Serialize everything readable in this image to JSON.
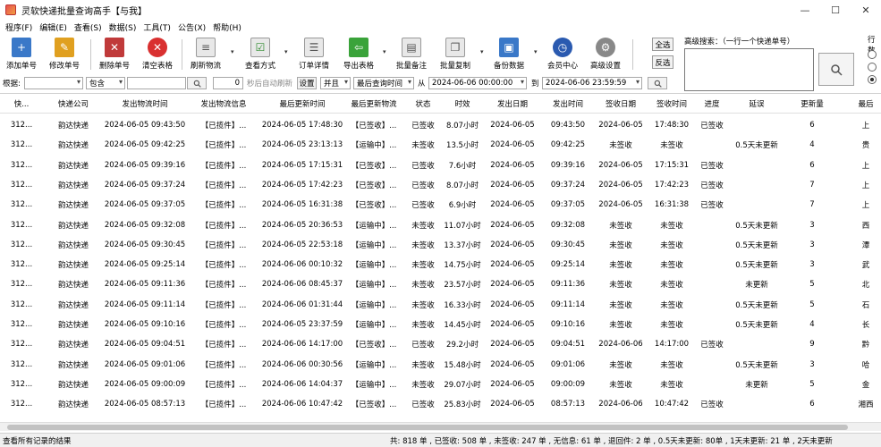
{
  "window": {
    "title": "灵软快递批量查询高手【与我】",
    "buttons": [
      "—",
      "☐",
      "✕"
    ]
  },
  "menu": [
    "程序(F)",
    "编辑(E)",
    "查看(S)",
    "数据(S)",
    "工具(T)",
    "公告(X)",
    "帮助(H)"
  ],
  "toolbar": {
    "add": "添加单号",
    "edit": "修改单号",
    "delete": "删除单号",
    "clear": "清空表格",
    "refresh": "刷新物流",
    "view_mode": "查看方式",
    "order_detail": "订单详情",
    "export": "导出表格",
    "batch_note": "批量备注",
    "batch_copy": "批量复制",
    "backup": "备份数据",
    "member": "会员中心",
    "settings": "高级设置",
    "select_all": "全选",
    "invert": "反选",
    "adv_search_label": "高级搜索：（一行一个快递单号）",
    "side_label": "行数"
  },
  "filter": {
    "label": "根据:",
    "field1": "",
    "match": "包含",
    "keyword": "",
    "seconds": "0",
    "auto_refresh": "秒后自动刷新",
    "settings_btn": "设置",
    "join": "并且",
    "field2": "最后查询时间",
    "from_label": "从",
    "from_date": "2024-06-06 00:00:00",
    "to_label": "到",
    "to_date": "2024-06-06 23:59:59"
  },
  "table": {
    "columns": [
      "快...",
      "快递公司",
      "发出物流时间",
      "发出物流信息",
      "最后更新时间",
      "最后更新物流",
      "状态",
      "时效",
      "发出日期",
      "发出时间",
      "签收日期",
      "签收时间",
      "进度",
      "延误",
      "更新量",
      "最后"
    ],
    "rows": [
      [
        "312...",
        "韵达快递",
        "2024-06-05 09:43:50",
        "【已揽件】...",
        "2024-06-05 17:48:30",
        "【已签收】...",
        "已签收",
        "8.07小时",
        "2024-06-05",
        "09:43:50",
        "2024-06-05",
        "17:48:30",
        "已签收",
        "",
        "6",
        "上"
      ],
      [
        "312...",
        "韵达快递",
        "2024-06-05 09:42:25",
        "【已揽件】...",
        "2024-06-05 23:13:13",
        "【运输中】...",
        "未签收",
        "13.5小时",
        "2024-06-05",
        "09:42:25",
        "未签收",
        "未签收",
        "",
        "0.5天未更新",
        "4",
        "贵"
      ],
      [
        "312...",
        "韵达快递",
        "2024-06-05 09:39:16",
        "【已揽件】...",
        "2024-06-05 17:15:31",
        "【已签收】...",
        "已签收",
        "7.6小时",
        "2024-06-05",
        "09:39:16",
        "2024-06-05",
        "17:15:31",
        "已签收",
        "",
        "6",
        "上"
      ],
      [
        "312...",
        "韵达快递",
        "2024-06-05 09:37:24",
        "【已揽件】...",
        "2024-06-05 17:42:23",
        "【已签收】...",
        "已签收",
        "8.07小时",
        "2024-06-05",
        "09:37:24",
        "2024-06-05",
        "17:42:23",
        "已签收",
        "",
        "7",
        "上"
      ],
      [
        "312...",
        "韵达快递",
        "2024-06-05 09:37:05",
        "【已揽件】...",
        "2024-06-05 16:31:38",
        "【已签收】...",
        "已签收",
        "6.9小时",
        "2024-06-05",
        "09:37:05",
        "2024-06-05",
        "16:31:38",
        "已签收",
        "",
        "7",
        "上"
      ],
      [
        "312...",
        "韵达快递",
        "2024-06-05 09:32:08",
        "【已揽件】...",
        "2024-06-05 20:36:53",
        "【运输中】...",
        "未签收",
        "11.07小时",
        "2024-06-05",
        "09:32:08",
        "未签收",
        "未签收",
        "",
        "0.5天未更新",
        "3",
        "西"
      ],
      [
        "312...",
        "韵达快递",
        "2024-06-05 09:30:45",
        "【已揽件】...",
        "2024-06-05 22:53:18",
        "【运输中】...",
        "未签收",
        "13.37小时",
        "2024-06-05",
        "09:30:45",
        "未签收",
        "未签收",
        "",
        "0.5天未更新",
        "3",
        "潭"
      ],
      [
        "312...",
        "韵达快递",
        "2024-06-05 09:25:14",
        "【已揽件】...",
        "2024-06-06 00:10:32",
        "【运输中】...",
        "未签收",
        "14.75小时",
        "2024-06-05",
        "09:25:14",
        "未签收",
        "未签收",
        "",
        "0.5天未更新",
        "3",
        "武"
      ],
      [
        "312...",
        "韵达快递",
        "2024-06-05 09:11:36",
        "【已揽件】...",
        "2024-06-06 08:45:37",
        "【运输中】...",
        "未签收",
        "23.57小时",
        "2024-06-05",
        "09:11:36",
        "未签收",
        "未签收",
        "",
        "未更新",
        "5",
        "北"
      ],
      [
        "312...",
        "韵达快递",
        "2024-06-05 09:11:14",
        "【已揽件】...",
        "2024-06-06 01:31:44",
        "【运输中】...",
        "未签收",
        "16.33小时",
        "2024-06-05",
        "09:11:14",
        "未签收",
        "未签收",
        "",
        "0.5天未更新",
        "5",
        "石"
      ],
      [
        "312...",
        "韵达快递",
        "2024-06-05 09:10:16",
        "【已揽件】...",
        "2024-06-05 23:37:59",
        "【运输中】...",
        "未签收",
        "14.45小时",
        "2024-06-05",
        "09:10:16",
        "未签收",
        "未签收",
        "",
        "0.5天未更新",
        "4",
        "长"
      ],
      [
        "312...",
        "韵达快递",
        "2024-06-05 09:04:51",
        "【已揽件】...",
        "2024-06-06 14:17:00",
        "【已签收】...",
        "已签收",
        "29.2小时",
        "2024-06-05",
        "09:04:51",
        "2024-06-06",
        "14:17:00",
        "已签收",
        "",
        "9",
        "黔"
      ],
      [
        "312...",
        "韵达快递",
        "2024-06-05 09:01:06",
        "【已揽件】...",
        "2024-06-06 00:30:56",
        "【运输中】...",
        "未签收",
        "15.48小时",
        "2024-06-05",
        "09:01:06",
        "未签收",
        "未签收",
        "",
        "0.5天未更新",
        "3",
        "哈"
      ],
      [
        "312...",
        "韵达快递",
        "2024-06-05 09:00:09",
        "【已揽件】...",
        "2024-06-06 14:04:37",
        "【运输中】...",
        "未签收",
        "29.07小时",
        "2024-06-05",
        "09:00:09",
        "未签收",
        "未签收",
        "",
        "未更新",
        "5",
        "金"
      ],
      [
        "312...",
        "韵达快递",
        "2024-06-05 08:57:13",
        "【已揽件】...",
        "2024-06-06 10:47:42",
        "【已签收】...",
        "已签收",
        "25.83小时",
        "2024-06-05",
        "08:57:13",
        "2024-06-06",
        "10:47:42",
        "已签收",
        "",
        "6",
        "湘西"
      ]
    ]
  },
  "status": {
    "left": "查看所有记录的结果",
    "right": "共: 818 单 , 已签收: 508 单 , 未签收: 247 单 , 无信息: 61 单 , 退回件: 2 单 , 0.5天未更新: 80单 , 1天未更新: 21 单 , 2天未更新"
  },
  "colors": {
    "accent_red": "#d93030",
    "accent_blue": "#3a78c8",
    "accent_green": "#3aa33a"
  }
}
